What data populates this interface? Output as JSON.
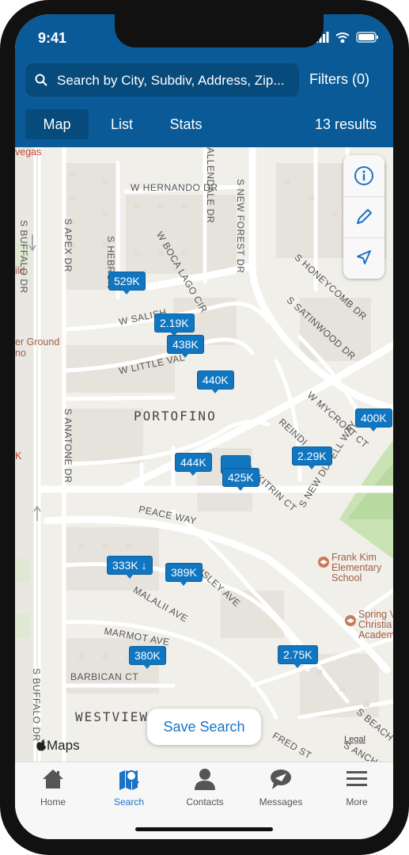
{
  "status": {
    "time": "9:41"
  },
  "search": {
    "placeholder": "Search by City, Subdiv, Address, Zip..."
  },
  "header": {
    "filters": "Filters (0)",
    "results": "13 results"
  },
  "tabs": [
    {
      "label": "Map",
      "active": true
    },
    {
      "label": "List",
      "active": false
    },
    {
      "label": "Stats",
      "active": false
    }
  ],
  "map": {
    "streets": [
      "S BUFFALO DR",
      "S APEX DR",
      "W HERNANDO DR",
      "ALLENDALE DR",
      "S NEW FOREST DR",
      "S HEBRON",
      "W BOCA LAGO CIR",
      "S HONEYCOMB DR",
      "S SATINWOOD DR",
      "W SALISH",
      "W LITTLE VAL",
      "W MYCROFT CT",
      "S ANATONE DR",
      "REINDI",
      "W KITRIN CT",
      "S NEW DUPELL WAY",
      "PEACE WAY",
      "ISLEY AVE",
      "MALALII AVE",
      "MARMOT AVE",
      "BARBICAN CT",
      "S BUFFALO DR",
      "FRED ST",
      "S BEACH",
      "S ANCHO"
    ],
    "areas": [
      "PORTOFINO",
      "WESTVIEW"
    ],
    "pois": [
      "Frank Kim Elementary School",
      "Spring V Christia Academ"
    ],
    "edge_texts": [
      "vegas",
      "ild",
      "er Ground",
      "no",
      "K"
    ],
    "pins": [
      "529K",
      "2.19K",
      "438K",
      "440K",
      "400K",
      "2.29K",
      "444K",
      "425K",
      "333K ↓",
      "389K",
      "380K",
      "2.75K"
    ],
    "maps_logo": "Maps",
    "legal": "Legal",
    "save_search": "Save Search"
  },
  "nav": [
    {
      "label": "Home",
      "icon": "home-icon",
      "active": false
    },
    {
      "label": "Search",
      "icon": "search-map-icon",
      "active": true
    },
    {
      "label": "Contacts",
      "icon": "contacts-icon",
      "active": false
    },
    {
      "label": "Messages",
      "icon": "messages-icon",
      "active": false
    },
    {
      "label": "More",
      "icon": "hamburger-icon",
      "active": false
    }
  ],
  "colors": {
    "brand": "#095a96",
    "pin": "#1176c0",
    "active_nav": "#1a73c8"
  }
}
